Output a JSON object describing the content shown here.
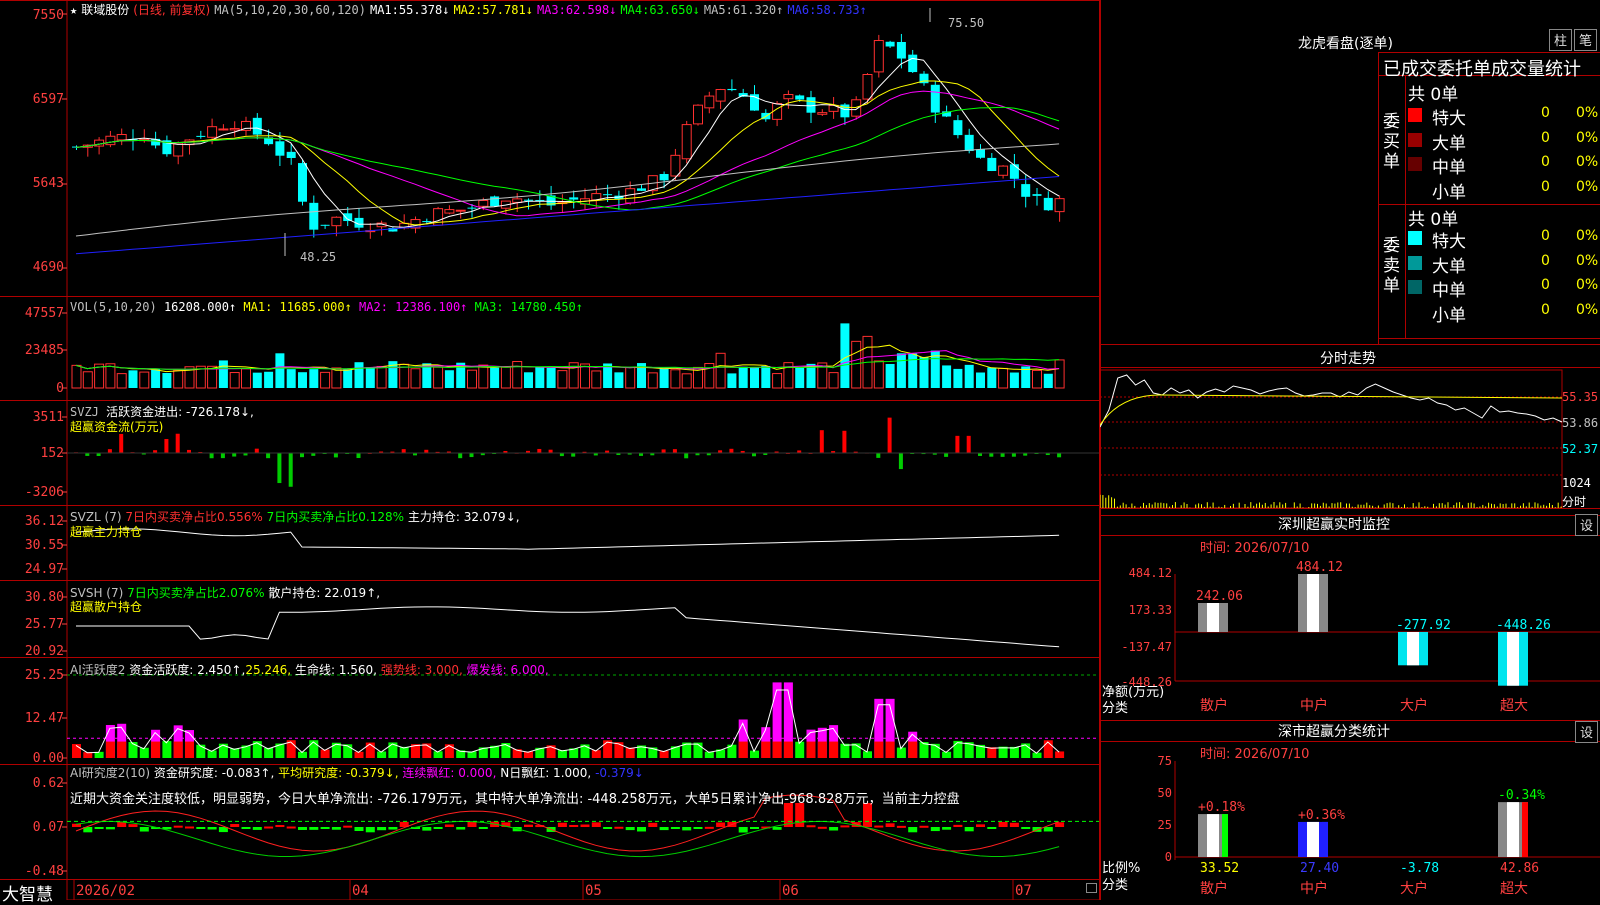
{
  "stock": {
    "name": "联域股份",
    "mode": "(日线, 前复权)",
    "ma_label": "MA(5,10,20,30,60,120)"
  },
  "ma": [
    {
      "label": "MA1:",
      "value": "55.378↓",
      "color": "#ffffff"
    },
    {
      "label": "MA2:",
      "value": "57.781↓",
      "color": "#ffff00"
    },
    {
      "label": "MA3:",
      "value": "62.598↓",
      "color": "#ff00ff"
    },
    {
      "label": "MA4:",
      "value": "63.650↓",
      "color": "#00ff00"
    },
    {
      "label": "MA5:",
      "value": "61.320↑",
      "color": "#c0c0c0"
    },
    {
      "label": "MA6:",
      "value": "58.733↑",
      "color": "#0000ff"
    }
  ],
  "price_axis": [
    "7550",
    "6597",
    "5643",
    "4690"
  ],
  "price_marks": {
    "high": "75.50",
    "low": "48.25"
  },
  "vol": {
    "header": "VOL(5,10,20)",
    "value": "16208.000↑",
    "ma1": "MA1: 11685.000↑",
    "ma2": "MA2: 12386.100↑",
    "ma3": "MA3: 14780.450↑",
    "axis": [
      "47557",
      "23485",
      "0"
    ]
  },
  "svzj": {
    "header": "SVZJ",
    "label": "活跃资金进出: -726.178↓,",
    "sub": "超赢资金流(万元)",
    "axis": [
      "3511",
      "152",
      "-3206"
    ]
  },
  "svzl": {
    "header": "SVZL (7)",
    "a": "7日内买卖净占比0.556%",
    "b": "7日内买卖净占比0.128%",
    "c": "主力持仓: 32.079↓,",
    "sub": "超赢主力持仓",
    "axis": [
      "36.12",
      "30.55",
      "24.97"
    ]
  },
  "svsh": {
    "header": "SVSH (7)",
    "a": "7日内买卖净占比2.076%",
    "b": "散户持仓: 22.019↑,",
    "sub": "超赢散户持仓",
    "axis": [
      "30.80",
      "25.77",
      "20.92"
    ]
  },
  "ai1": {
    "header": "AI活跃度2",
    "a": "资金活跃度: 2.450↑,",
    "b": "25.246,",
    "c": "生命线: 1.560,",
    "d": "强势线: 3.000,",
    "e": "爆发线: 6.000,",
    "axis": [
      "25.25",
      "12.47",
      "0.00"
    ]
  },
  "ai2": {
    "header": "AI研究度2(10)",
    "a": "资金研究度: -0.083↑,",
    "b": "平均研究度: -0.379↓,",
    "c": "连续飘红: 0.000,",
    "d": "N日飘红: 1.000,",
    "e": "-0.379↓",
    "note": "近期大资金关注度较低，明显弱势，今日大单净流出: -726.179万元，其中特大单净流出: -448.258万元，大单5日累计净出-968.828万元，当前主力控盘",
    "axis": [
      "0.62",
      "0.07",
      "-0.48"
    ]
  },
  "date_axis": [
    "2026/02",
    "04",
    "05",
    "06",
    "07"
  ],
  "brand": "大智慧",
  "right": {
    "dragon_title": "龙虎看盘(逐单)",
    "btn_zhu": "柱",
    "btn_bi": "笔",
    "table_title": "已成交委托单成交量统计",
    "buy_label": "委买单",
    "sell_label": "委卖单",
    "buy_count": "共 0单",
    "sell_count": "共 0单",
    "buy_rows": [
      {
        "name": "特大",
        "val": "0",
        "pct": "0%",
        "color": "#ff0000"
      },
      {
        "name": "大单",
        "val": "0",
        "pct": "0%",
        "color": "#990000"
      },
      {
        "name": "中单",
        "val": "0",
        "pct": "0%",
        "color": "#660000"
      },
      {
        "name": "小单",
        "val": "0",
        "pct": "0%",
        "color": ""
      }
    ],
    "sell_rows": [
      {
        "name": "特大",
        "val": "0",
        "pct": "0%",
        "color": "#00ffff"
      },
      {
        "name": "大单",
        "val": "0",
        "pct": "0%",
        "color": "#009999"
      },
      {
        "name": "中单",
        "val": "0",
        "pct": "0%",
        "color": "#006666"
      },
      {
        "name": "小单",
        "val": "0",
        "pct": "0%",
        "color": ""
      }
    ],
    "intraday_title": "分时走势",
    "intraday_axis": [
      "55.35",
      "53.86",
      "52.37"
    ],
    "intraday_vol": [
      "1024",
      "分时"
    ],
    "sz_title": "深圳超赢实时监控",
    "set": "设",
    "sz_time": "时间: 2026/07/10",
    "sz_axis": [
      "484.12",
      "173.33",
      "-137.47",
      "-448.26"
    ],
    "sz_unit": [
      "净额(万元)",
      "分类"
    ],
    "sz_bars": [
      {
        "name": "散户",
        "value": 242.06,
        "label": "242.06"
      },
      {
        "name": "中户",
        "value": 484.12,
        "label": "484.12"
      },
      {
        "name": "大户",
        "value": -277.92,
        "label": "-277.92"
      },
      {
        "name": "超大",
        "value": -448.26,
        "label": "-448.26"
      }
    ],
    "cls_title": "深市超赢分类统计",
    "cls_time": "时间: 2026/07/10",
    "cls_axis": [
      "75",
      "50",
      "25",
      "0"
    ],
    "cls_unit": [
      "比例%",
      "分类"
    ],
    "cls_bars": [
      {
        "name": "散户",
        "value": 33.52,
        "label": "33.52",
        "chg": "+0.18%"
      },
      {
        "name": "中户",
        "value": 27.4,
        "label": "27.40",
        "chg": "+0.36%"
      },
      {
        "name": "大户",
        "value": -3.78,
        "label": "-3.78",
        "chg": ""
      },
      {
        "name": "超大",
        "value": 42.86,
        "label": "42.86",
        "chg": "-0.34%"
      }
    ]
  },
  "colors": {
    "up": "#ff3030",
    "down": "#00ffff",
    "grid": "#b00000",
    "axis_text": "#ff4040"
  }
}
